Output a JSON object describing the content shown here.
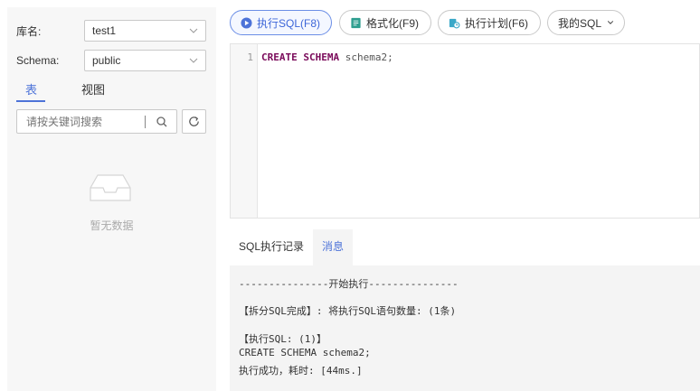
{
  "sidebar": {
    "db_label": "库名:",
    "db_value": "test1",
    "schema_label": "Schema:",
    "schema_value": "public",
    "tabs": [
      {
        "label": "表",
        "active": true
      },
      {
        "label": "视图",
        "active": false
      }
    ],
    "search_placeholder": "请按关键词搜索",
    "empty_text": "暂无数据"
  },
  "toolbar": {
    "run_label": "执行SQL(F8)",
    "format_label": "格式化(F9)",
    "plan_label": "执行计划(F6)",
    "mysql_label": "我的SQL"
  },
  "editor": {
    "line_number": "1",
    "keyword_1": "CREATE",
    "keyword_2": "SCHEMA",
    "rest": " schema2;"
  },
  "result_tabs": [
    {
      "label": "SQL执行记录",
      "active": false
    },
    {
      "label": "消息",
      "active": true
    }
  ],
  "messages": [
    "---------------开始执行---------------",
    "【拆分SQL完成】: 将执行SQL语句数量: (1条)",
    "【执行SQL: (1)】",
    "CREATE SCHEMA schema2;",
    "执行成功，耗时: [44ms.]"
  ],
  "colors": {
    "accent": "#4d73d8",
    "keyword": "#7a0a5a"
  }
}
